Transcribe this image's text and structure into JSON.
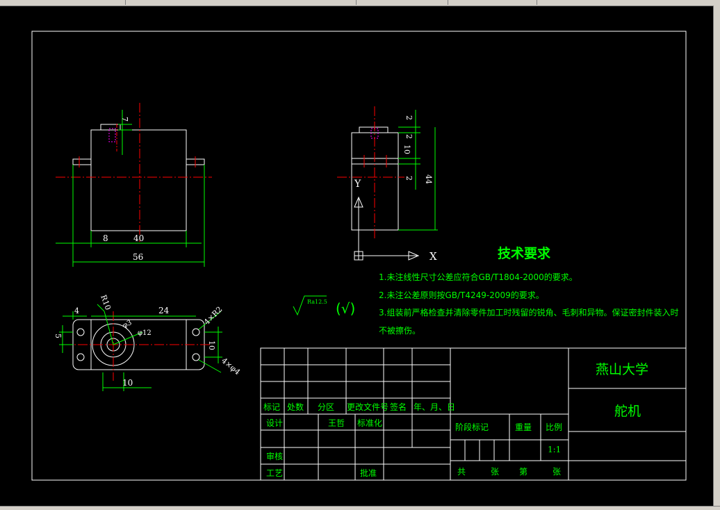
{
  "app": {
    "accent_colors": {
      "outline": "#ffffff",
      "center": "#ff0000",
      "dimension": "#00ff00",
      "hidden": "#ff00ff",
      "note": "#00ff00"
    }
  },
  "front_view": {
    "dims": {
      "width": "40",
      "flange": "8",
      "overall": "56",
      "boss": "7"
    }
  },
  "side_view": {
    "dims": {
      "d1": "2",
      "d2": "2",
      "d3": "10",
      "d4": "2",
      "height": "44"
    },
    "axis_y": "Y",
    "axis_x": "X"
  },
  "top_view": {
    "dims": {
      "width": "24",
      "left": "4",
      "side": "5",
      "radius": "R10",
      "hole": "φ12",
      "small": "φ3",
      "holes_r": "4×R2",
      "holes_d": "4×φ4",
      "height": "10",
      "pitch": "10"
    }
  },
  "tech_requirements": {
    "title": "技术要求",
    "items": [
      "1.未注线性尺寸公差应符合GB/T1804-2000的要求。",
      "2.未注公差原则按GB/T4249-2009的要求。",
      "3.组装前严格检查并清除零件加工时残留的锐角、毛刺和异物。保证密封件装入时",
      "不被擦伤。"
    ]
  },
  "roughness": {
    "value": "Ra12.5",
    "mark": "(√)"
  },
  "title_block": {
    "university": "燕山大学",
    "part_name": "舵机",
    "headers": [
      "标记",
      "处数",
      "分区",
      "更改文件号",
      "签名",
      "年、月、日"
    ],
    "design_label": "设计",
    "designer": "王哲",
    "standardize": "标准化",
    "review": "审核",
    "process": "工艺",
    "approve": "批准",
    "stage_mark": "阶段标记",
    "weight": "重量",
    "scale_label": "比例",
    "scale": "1:1",
    "total": "共",
    "sheets": "张",
    "sheet_no": "第",
    "sheet_unit": "张"
  }
}
